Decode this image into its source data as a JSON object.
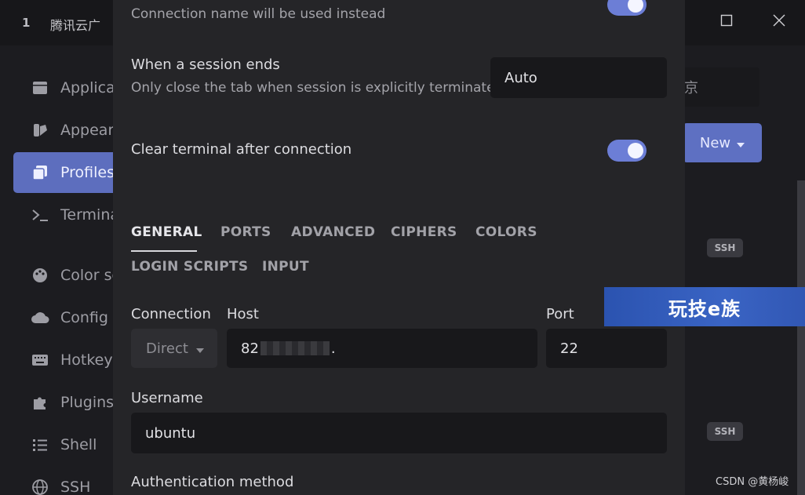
{
  "window": {
    "tab_number": "1",
    "tab_title": "腾讯云广",
    "minimize_icon": "minimize-icon",
    "maximize_icon": "maximize-icon",
    "close_icon": "close-icon"
  },
  "sidebar": {
    "items": [
      {
        "label": "Applicat",
        "icon": "window-icon"
      },
      {
        "label": "Appeara",
        "icon": "palette-brush-icon"
      },
      {
        "label": "Profiles",
        "icon": "profiles-icon",
        "active": true
      },
      {
        "label": "Termina",
        "icon": "terminal-icon"
      },
      {
        "label": "Color sc",
        "icon": "color-palette-icon"
      },
      {
        "label": "Config s",
        "icon": "cloud-icon"
      },
      {
        "label": "Hotkeys",
        "icon": "keyboard-icon"
      },
      {
        "label": "Plugins",
        "icon": "puzzle-icon"
      },
      {
        "label": "Shell",
        "icon": "list-icon"
      },
      {
        "label": "SSH",
        "icon": "globe-icon"
      }
    ]
  },
  "background": {
    "field_fragment": "京",
    "new_button_label": "New",
    "badges": [
      "SSH",
      "SSH"
    ],
    "csdn_credit": "CSDN @黄杨峻",
    "watermark": "玩技e族"
  },
  "dialog": {
    "connection_name_hint": "Connection name will be used instead",
    "session_end": {
      "title": "When a session ends",
      "description": "Only close the tab when session is explicitly terminated",
      "value": "Auto"
    },
    "clear_terminal": {
      "label": "Clear terminal after connection"
    },
    "tabs": [
      "GENERAL",
      "PORTS",
      "ADVANCED",
      "CIPHERS",
      "COLORS",
      "LOGIN SCRIPTS",
      "INPUT"
    ],
    "connection": {
      "label": "Connection",
      "value": "Direct"
    },
    "host": {
      "label": "Host",
      "value_start": "82",
      "value_end": "."
    },
    "port": {
      "label": "Port",
      "value": "22"
    },
    "username": {
      "label": "Username",
      "value": "ubuntu"
    },
    "auth": {
      "label": "Authentication method"
    }
  },
  "colors": {
    "accent": "#5d6ebe",
    "toggle": "#6c7ed6",
    "dialog_bg": "#252528",
    "input_bg": "#18181b"
  }
}
